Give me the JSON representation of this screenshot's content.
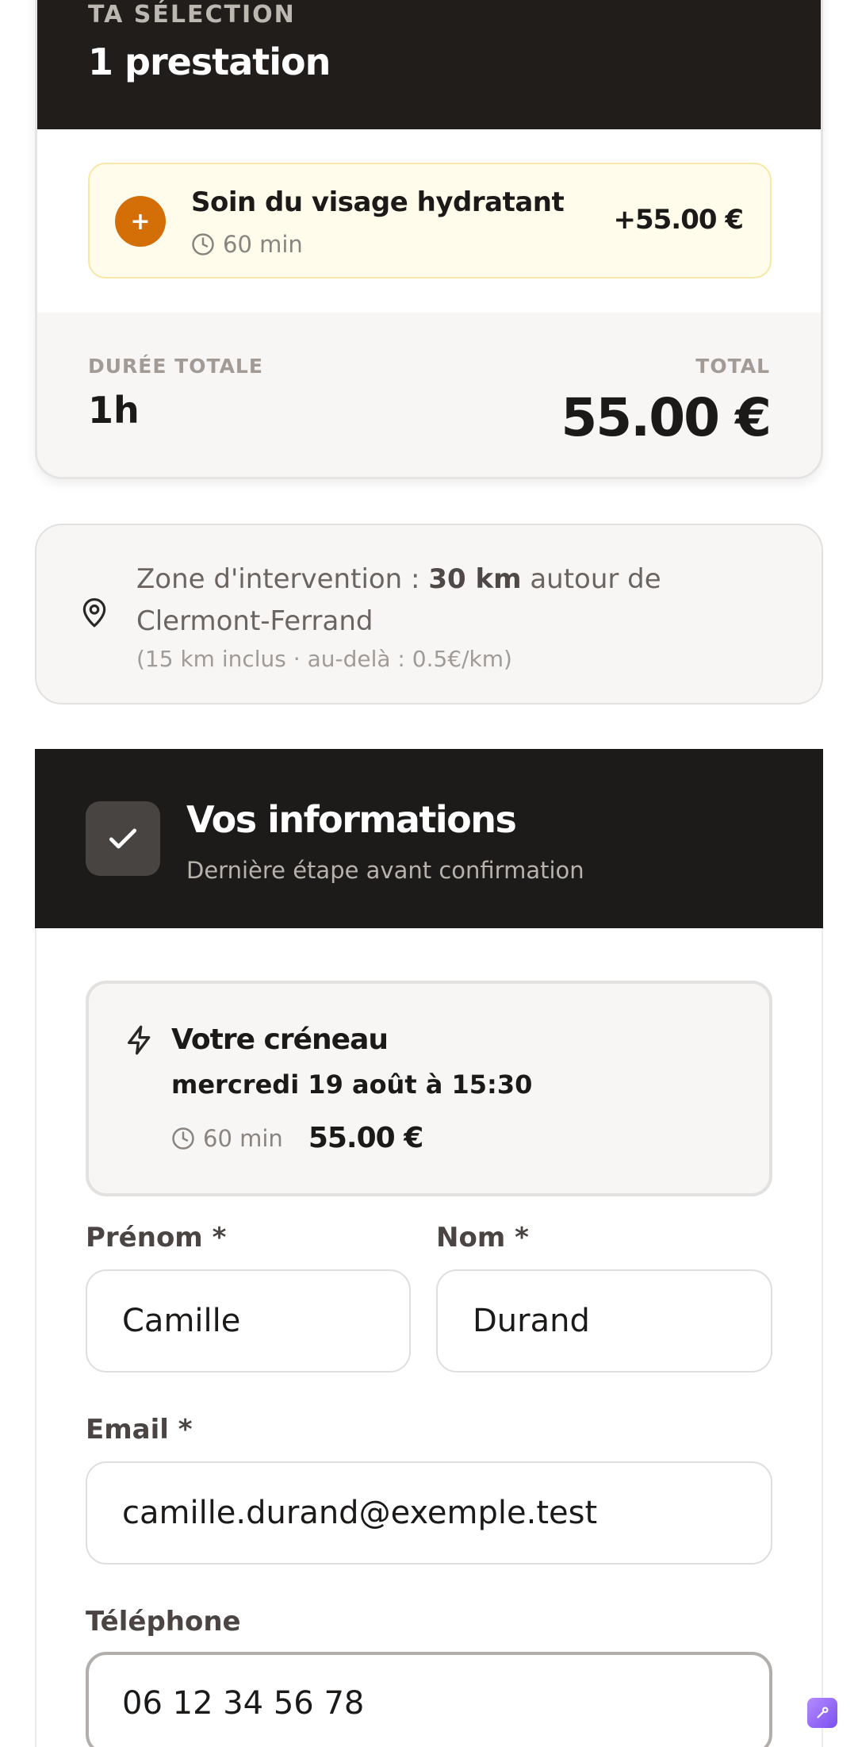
{
  "selection": {
    "eyebrow": "TA SÉLECTION",
    "count_title": "1 prestation",
    "item": {
      "icon": "plus-icon",
      "icon_glyph": "+",
      "name": "Soin du visage hydratant",
      "duration": "60 min",
      "price": "+55.00 €"
    },
    "total_duration_label": "DURÉE TOTALE",
    "total_duration": "1h",
    "total_label": "TOTAL",
    "total_price": "55.00 €"
  },
  "zone": {
    "icon": "map-pin-icon",
    "prefix": "Zone d'intervention :",
    "distance": "30 km",
    "suffix": "autour de Clermont-Ferrand",
    "detail": "(15 km inclus · au-delà : 0.5€/km)"
  },
  "info": {
    "icon": "check-icon",
    "title": "Vos informations",
    "subtitle": "Dernière étape avant confirmation",
    "slot": {
      "icon": "lightning-icon",
      "title": "Votre créneau",
      "date": "mercredi 19 août à 15:30",
      "duration": "60 min",
      "price": "55.00 €"
    },
    "fields": {
      "first_name_label": "Prénom *",
      "first_name_value": "Camille",
      "last_name_label": "Nom *",
      "last_name_value": "Durand",
      "email_label": "Email *",
      "email_value": "camille.durand@exemple.test",
      "phone_label": "Téléphone",
      "phone_value": "06 12 34 56 78"
    }
  },
  "colors": {
    "accent_orange": "#d46f08",
    "dark_header": "#1d1b1a",
    "highlight_bg": "#fffcec"
  }
}
